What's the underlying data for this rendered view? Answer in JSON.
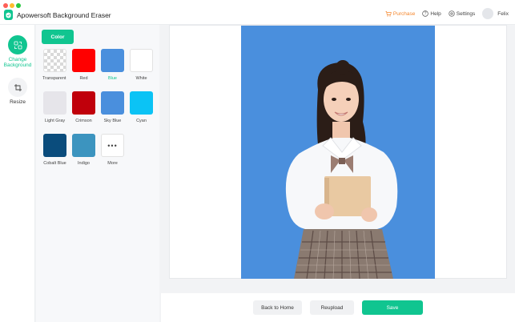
{
  "app": {
    "title": "Apowersoft Background Eraser",
    "logo_icon": "leaf-logo-icon"
  },
  "top_nav": {
    "purchase": "Purchase",
    "help": "Help",
    "settings": "Settings",
    "user": "Felix"
  },
  "left_rail": {
    "items": [
      {
        "label": "Change Background",
        "icon": "change-background-icon",
        "active": true
      },
      {
        "label": "Resize",
        "icon": "resize-icon",
        "active": false
      }
    ]
  },
  "color_panel": {
    "tab_label": "Color",
    "selected": "Blue",
    "swatches": [
      {
        "label": "Transparent",
        "color": "transparent"
      },
      {
        "label": "Red",
        "color": "#ff0000"
      },
      {
        "label": "Blue",
        "color": "#4a8fdd"
      },
      {
        "label": "White",
        "color": "#ffffff"
      },
      {
        "label": "Light Gray",
        "color": "#e6e5ea"
      },
      {
        "label": "Crimson",
        "color": "#c0000b"
      },
      {
        "label": "Sky Blue",
        "color": "#4a8fdd"
      },
      {
        "label": "Cyan",
        "color": "#0bc3f5"
      },
      {
        "label": "Cobalt Blue",
        "color": "#0a4c7c"
      },
      {
        "label": "Indigo",
        "color": "#3c94bf"
      },
      {
        "label": "More",
        "color": "#ffffff"
      }
    ]
  },
  "preview": {
    "background_color": "#4a8fdd"
  },
  "actions": {
    "back_home": "Back to Home",
    "reupload": "Reupload",
    "save": "Save"
  },
  "colors": {
    "accent": "#10c590",
    "purchase": "#f5872d"
  }
}
